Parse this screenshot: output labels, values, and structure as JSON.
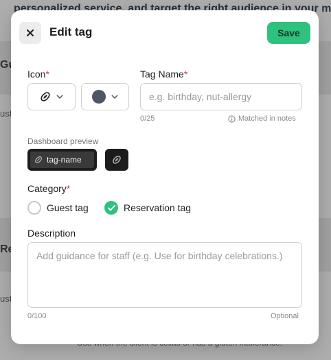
{
  "background": {
    "top_text": "personalized service, and target the right audience in your marketing cam",
    "fragments": [
      "Gu",
      "ust",
      "Res",
      "ust"
    ],
    "bottom_text": "Use when the client is celiac or has a gluten intolerance."
  },
  "modal": {
    "title": "Edit tag",
    "save_label": "Save",
    "close_icon": "close-icon"
  },
  "icon_field": {
    "label": "Icon",
    "required_mark": "*",
    "selected_icon": "football-icon",
    "selected_color": "#4d5566"
  },
  "tag_name": {
    "label": "Tag Name",
    "required_mark": "*",
    "value": "",
    "placeholder": "e.g. birthday, nut-allergy",
    "counter": "0/25",
    "hint": "Matched in notes"
  },
  "preview": {
    "label": "Dashboard preview",
    "chip_text": "tag-name"
  },
  "category": {
    "label": "Category",
    "required_mark": "*",
    "options": [
      {
        "label": "Guest tag",
        "selected": false
      },
      {
        "label": "Reservation tag",
        "selected": true
      }
    ]
  },
  "description": {
    "label": "Description",
    "value": "",
    "placeholder": "Add guidance for staff (e.g. Use for birthday celebrations.)",
    "counter": "0/100",
    "optional_label": "Optional"
  },
  "colors": {
    "accent": "#2ec27e",
    "required": "#d63a3a",
    "chip_bg": "#1c1c1c"
  }
}
